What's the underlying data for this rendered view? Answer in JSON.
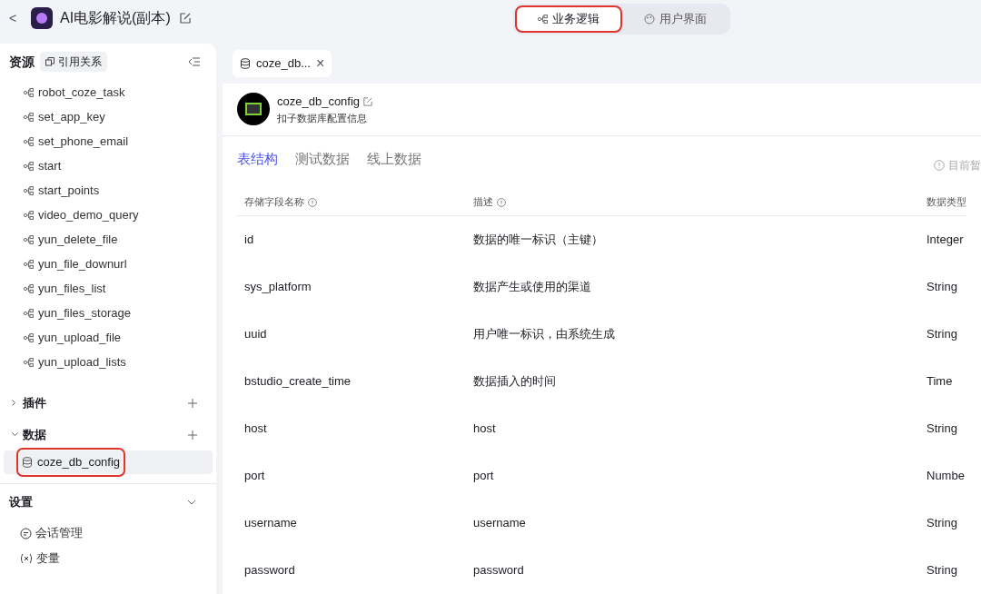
{
  "header": {
    "back": "<",
    "title": "AI电影解说(副本)"
  },
  "mode_tabs": [
    {
      "label": "业务逻辑",
      "selected": true,
      "highlighted": true
    },
    {
      "label": "用户界面",
      "selected": false,
      "highlighted": false
    }
  ],
  "sidebar": {
    "title": "资源",
    "reference_button": "引用关系",
    "workflows": [
      "robot_coze_task",
      "set_app_key",
      "set_phone_email",
      "start",
      "start_points",
      "video_demo_query",
      "yun_delete_file",
      "yun_file_downurl",
      "yun_files_list",
      "yun_files_storage",
      "yun_upload_file",
      "yun_upload_lists"
    ],
    "groups": [
      {
        "label": "插件",
        "expanded": false
      },
      {
        "label": "数据",
        "expanded": true,
        "items": [
          {
            "label": "coze_db_config",
            "selected": true,
            "highlighted": true
          }
        ]
      }
    ],
    "settings": {
      "label": "设置",
      "items": [
        {
          "kind": "chat",
          "label": "会话管理"
        },
        {
          "kind": "variable",
          "label": "变量"
        }
      ]
    }
  },
  "editor_tab": {
    "label": "coze_db...",
    "close": "×"
  },
  "database": {
    "name": "coze_db_config",
    "description": "扣子数据库配置信息",
    "tabs": [
      {
        "label": "表结构",
        "selected": true
      },
      {
        "label": "测试数据",
        "selected": false
      },
      {
        "label": "线上数据",
        "selected": false
      }
    ],
    "notice": "目前暂",
    "table": {
      "columns": [
        "存储字段名称",
        "描述",
        "数据类型"
      ],
      "rows": [
        [
          "id",
          "数据的唯一标识（主键）",
          "Integer"
        ],
        [
          "sys_platform",
          "数据产生或使用的渠道",
          "String"
        ],
        [
          "uuid",
          "用户唯一标识，由系统生成",
          "String"
        ],
        [
          "bstudio_create_time",
          "数据插入的时间",
          "Time"
        ],
        [
          "host",
          "host",
          "String"
        ],
        [
          "port",
          "port",
          "Numbe"
        ],
        [
          "username",
          "username",
          "String"
        ],
        [
          "password",
          "password",
          "String"
        ]
      ]
    }
  }
}
